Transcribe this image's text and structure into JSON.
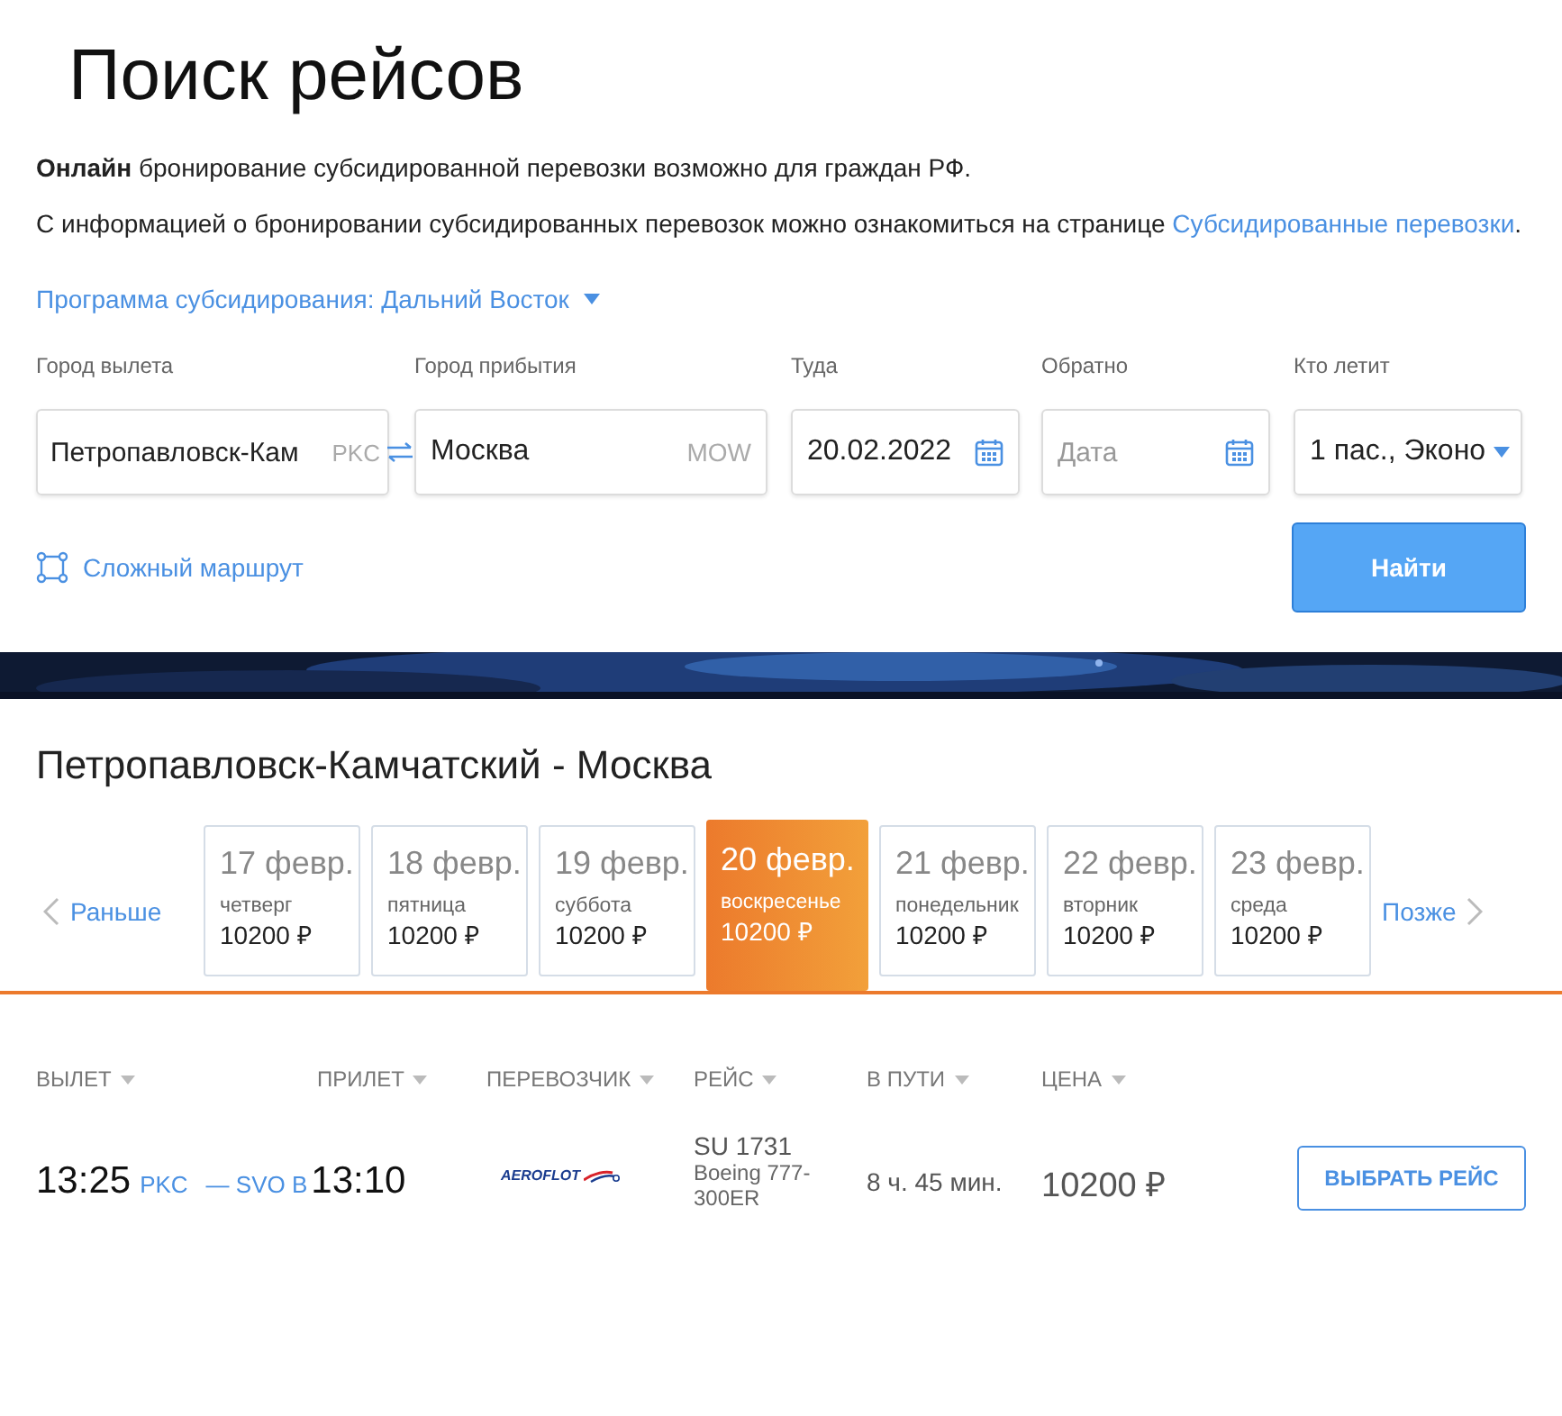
{
  "title": "Поиск рейсов",
  "info": [
    "**Онлайн** бронирование субсидированной перевозки возможно для граждан РФ."
  ],
  "info_link_text": "С информацией о бронировании субсидированных перевозок можно ознакомиться на странице",
  "info_link": "Субсидированные перевозки",
  "info_end": ".",
  "program": "Программа субсидирования: Дальний Восток",
  "fields": [
    {
      "kind": "city",
      "label": "Город вылета",
      "value": "Петропавловск-Кам",
      "code": "PKC"
    },
    {
      "kind": "city",
      "label": "Город прибытия",
      "value": "Москва",
      "code": "MOW"
    },
    {
      "kind": "date",
      "label": "Туда",
      "value": "20.02.2022"
    },
    {
      "kind": "date",
      "label": "Обратно",
      "placeholder": "Дата"
    },
    {
      "kind": "select",
      "label": "Кто летит",
      "value": "1 пас., Эконо"
    }
  ],
  "complex_route": "Сложный маршрут",
  "search_button": "Найти",
  "route_title": "Петропавловск-Камчатский - Москва",
  "earlier": "Раньше",
  "later": "Позже",
  "days": [
    {
      "date": "17 февр.",
      "weekday": "четверг",
      "price": "10200 ₽",
      "selected": false
    },
    {
      "date": "18 февр.",
      "weekday": "пятница",
      "price": "10200 ₽",
      "selected": false
    },
    {
      "date": "19 февр.",
      "weekday": "суббота",
      "price": "10200 ₽",
      "selected": false
    },
    {
      "date": "20 февр.",
      "weekday": "воскресенье",
      "price": "10200 ₽",
      "selected": true
    },
    {
      "date": "21 февр.",
      "weekday": "понедельник",
      "price": "10200 ₽",
      "selected": false
    },
    {
      "date": "22 февр.",
      "weekday": "вторник",
      "price": "10200 ₽",
      "selected": false
    },
    {
      "date": "23 февр.",
      "weekday": "среда",
      "price": "10200 ₽",
      "selected": false
    }
  ],
  "columns": [
    "ВЫЛЕТ",
    "ПРИЛЕТ",
    "ПЕРЕВОЗЧИК",
    "РЕЙС",
    "В ПУТИ",
    "ЦЕНА"
  ],
  "flights": [
    {
      "dep_time": "13:25",
      "dep_code": "PKC",
      "arr_code": "— SVO B",
      "arr_time": "13:10",
      "airline": "AEROFLOT",
      "flight": "SU 1731",
      "aircraft": "Boeing 777-300ER",
      "duration": "8 ч. 45 мин.",
      "price": "10200 ₽",
      "button": "ВЫБРАТЬ РЕЙС"
    }
  ]
}
